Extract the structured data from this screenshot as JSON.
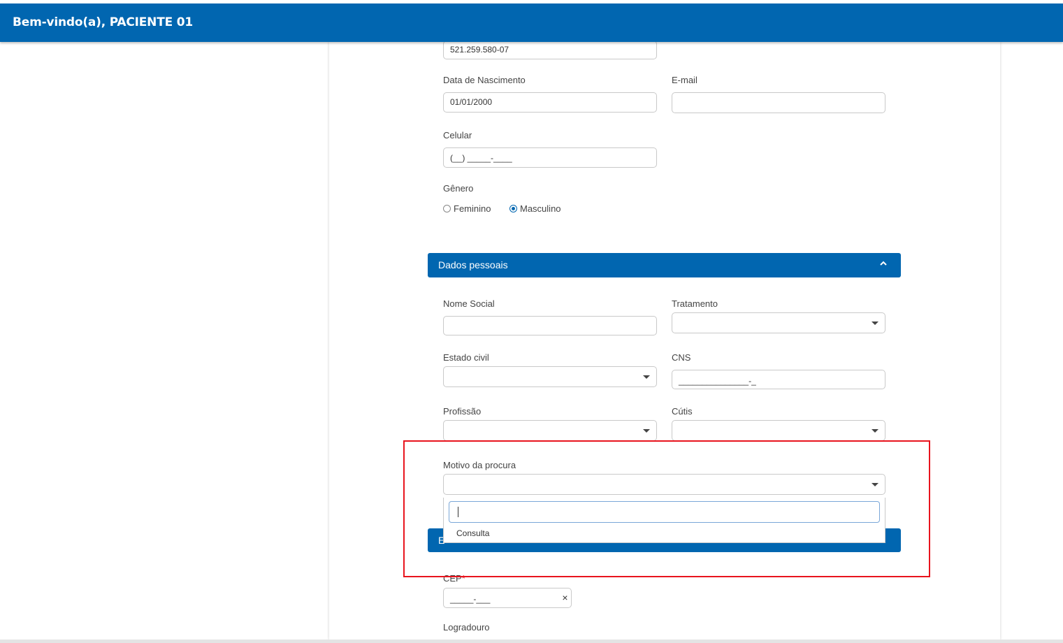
{
  "header": {
    "title": "Bem-vindo(a), PACIENTE 01"
  },
  "form": {
    "cpf_value": "521.259.580-07",
    "birth": {
      "label": "Data de Nascimento",
      "value": "01/01/2000"
    },
    "email": {
      "label": "E-mail",
      "value": ""
    },
    "phone": {
      "label": "Celular",
      "value": "(__) _____-____"
    },
    "gender": {
      "label": "Gênero",
      "options": [
        "Feminino",
        "Masculino"
      ],
      "selected": "Masculino"
    }
  },
  "personal": {
    "title": "Dados pessoais",
    "social_name": {
      "label": "Nome Social",
      "value": ""
    },
    "treatment": {
      "label": "Tratamento",
      "value": ""
    },
    "marital": {
      "label": "Estado civil",
      "value": ""
    },
    "cns": {
      "label": "CNS",
      "value": "_______________-_"
    },
    "profession": {
      "label": "Profissão",
      "value": ""
    },
    "skin": {
      "label": "Cútis",
      "value": ""
    },
    "reason": {
      "label": "Motivo da procura",
      "value": ""
    },
    "reason_options": [
      "Consulta"
    ]
  },
  "address": {
    "title_partial": "E",
    "cep": {
      "label": "CEP",
      "required_mark": "*",
      "value": "_____-___"
    },
    "street": {
      "label": "Logradouro"
    },
    "clear_symbol": "×"
  },
  "colors": {
    "primary": "#0166b0",
    "highlight": "#e8141d"
  }
}
